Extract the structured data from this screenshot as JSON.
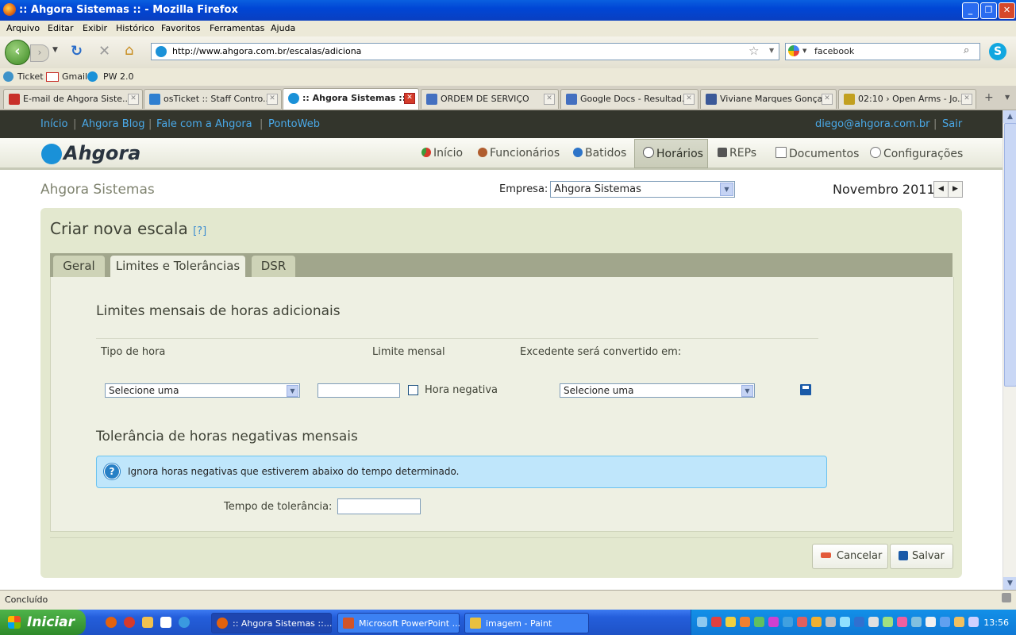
{
  "window": {
    "title": ":: Ahgora Sistemas :: - Mozilla Firefox"
  },
  "menu": [
    "Arquivo",
    "Editar",
    "Exibir",
    "Histórico",
    "Favoritos",
    "Ferramentas",
    "Ajuda"
  ],
  "nav": {
    "url": "http://www.ahgora.com.br/escalas/adiciona",
    "search_value": "facebook"
  },
  "bookmarks": [
    "Ticket",
    "Gmail",
    "PW 2.0"
  ],
  "browser_tabs": [
    {
      "label": "E-mail de Ahgora Siste...",
      "color": "#c8302a"
    },
    {
      "label": "osTicket :: Staff Contro...",
      "color": "#2f7fd0"
    },
    {
      "label": ":: Ahgora Sistemas ::",
      "color": "#1a91d8"
    },
    {
      "label": "ORDEM DE SERVIÇO",
      "color": "#4470c0"
    },
    {
      "label": "Google Docs - Resultad...",
      "color": "#4470c0"
    },
    {
      "label": "Viviane Marques Gonçal...",
      "color": "#3b5998"
    },
    {
      "label": "02:10 › Open Arms - Jo...",
      "color": "#c2a020"
    }
  ],
  "site": {
    "topnav": [
      "Início",
      "Ahgora Blog",
      "Fale com a Ahgora",
      "PontoWeb"
    ],
    "user_email": "diego@ahgora.com.br",
    "logout": "Sair",
    "logo": "Ahgora",
    "mainnav": [
      "Início",
      "Funcionários",
      "Batidos",
      "Horários",
      "REPs",
      "Documentos",
      "Configurações"
    ],
    "company_header": "Ahgora Sistemas",
    "empresa_label": "Empresa:",
    "empresa_value": "Ahgora Sistemas",
    "month": "Novembro 2011",
    "prev": "◀",
    "next": "▶"
  },
  "form": {
    "title": "Criar nova escala",
    "help": "[?]",
    "tabs": [
      "Geral",
      "Limites e Tolerâncias",
      "DSR"
    ],
    "section1": "Limites mensais de horas adicionais",
    "col_tipo": "Tipo de hora",
    "col_limite": "Limite mensal",
    "col_excedente": "Excedente será convertido em:",
    "select_tipo": "Selecione uma",
    "limit_value": "",
    "hora_negativa": "Hora negativa",
    "select_excedente": "Selecione uma",
    "section2": "Tolerância de horas negativas mensais",
    "info": "Ignora horas negativas que estiverem abaixo do tempo determinado.",
    "tolerancia_label": "Tempo de tolerância:",
    "tolerancia_value": "",
    "cancel": "Cancelar",
    "save": "Salvar"
  },
  "status": "Concluído",
  "taskbar": {
    "start": "Iniciar",
    "items": [
      ":: Ahgora Sistemas ::...",
      "Microsoft PowerPoint ...",
      "imagem - Paint"
    ],
    "clock": "13:56"
  }
}
